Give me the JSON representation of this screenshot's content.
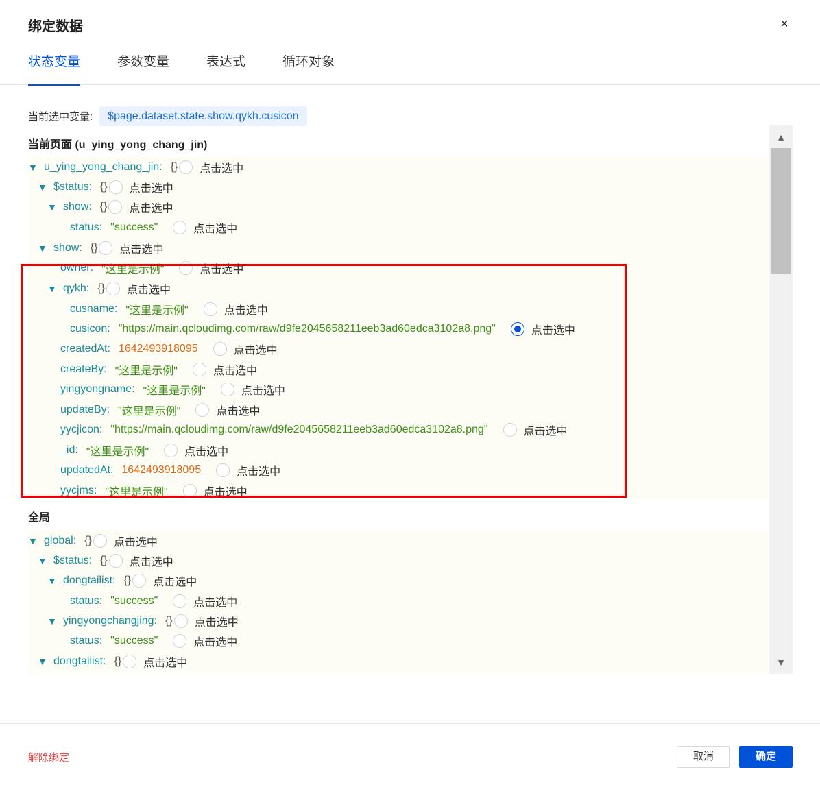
{
  "dialog": {
    "title": "绑定数据",
    "close_icon": "×"
  },
  "tabs": [
    {
      "label": "状态变量",
      "active": true
    },
    {
      "label": "参数变量"
    },
    {
      "label": "表达式"
    },
    {
      "label": "循环对象"
    }
  ],
  "current": {
    "label": "当前选中变量:",
    "value": "$page.dataset.state.show.qykh.cusicon"
  },
  "sections": {
    "page_title": "当前页面 (u_ying_yong_chang_jin)",
    "global_title": "全局"
  },
  "pick_label": "点击选中",
  "page_tree": [
    {
      "arrow": "▼",
      "key": "u_ying_yong_chang_jin:",
      "brace": "{}"
    },
    {
      "arrow": "▼",
      "key": "$status:",
      "brace": "{}"
    },
    {
      "arrow": "▼",
      "key": "show:",
      "brace": "{}"
    },
    {
      "key": "status:",
      "str": "\"success\""
    },
    {
      "arrow": "▼",
      "key": "show:",
      "brace": "{}"
    },
    {
      "key": "owner:",
      "str": "\"这里是示例\""
    },
    {
      "arrow": "▼",
      "key": "qykh:",
      "brace": "{}"
    },
    {
      "key": "cusname:",
      "str": "\"这里是示例\""
    },
    {
      "key": "cusicon:",
      "str": "\"https://main.qcloudimg.com/raw/d9fe2045658211eeb3ad60edca3102a8.png\"",
      "checked": true
    },
    {
      "key": "createdAt:",
      "num": "1642493918095"
    },
    {
      "key": "createBy:",
      "str": "\"这里是示例\""
    },
    {
      "key": "yingyongname:",
      "str": "\"这里是示例\""
    },
    {
      "key": "updateBy:",
      "str": "\"这里是示例\""
    },
    {
      "key": "yycjicon:",
      "str": "\"https://main.qcloudimg.com/raw/d9fe2045658211eeb3ad60edca3102a8.png\""
    },
    {
      "key": "_id:",
      "str": "\"这里是示例\""
    },
    {
      "key": "updatedAt:",
      "num": "1642493918095"
    },
    {
      "key": "yycjms:",
      "str": "\"这里是示例\""
    }
  ],
  "global_tree": [
    {
      "arrow": "▼",
      "key": "global:",
      "brace": "{}"
    },
    {
      "arrow": "▼",
      "key": "$status:",
      "brace": "{}"
    },
    {
      "arrow": "▼",
      "key": "dongtailist:",
      "brace": "{}"
    },
    {
      "key": "status:",
      "str": "\"success\""
    },
    {
      "arrow": "▼",
      "key": "yingyongchangjing:",
      "brace": "{}"
    },
    {
      "key": "status:",
      "str": "\"success\""
    },
    {
      "arrow": "▼",
      "key": "dongtailist:",
      "brace": "{}"
    }
  ],
  "scrollbar": {
    "up_icon": "▲",
    "down_icon": "▼"
  },
  "footer": {
    "unbind_label": "解除绑定",
    "cancel_label": "取消",
    "ok_label": "确定"
  }
}
